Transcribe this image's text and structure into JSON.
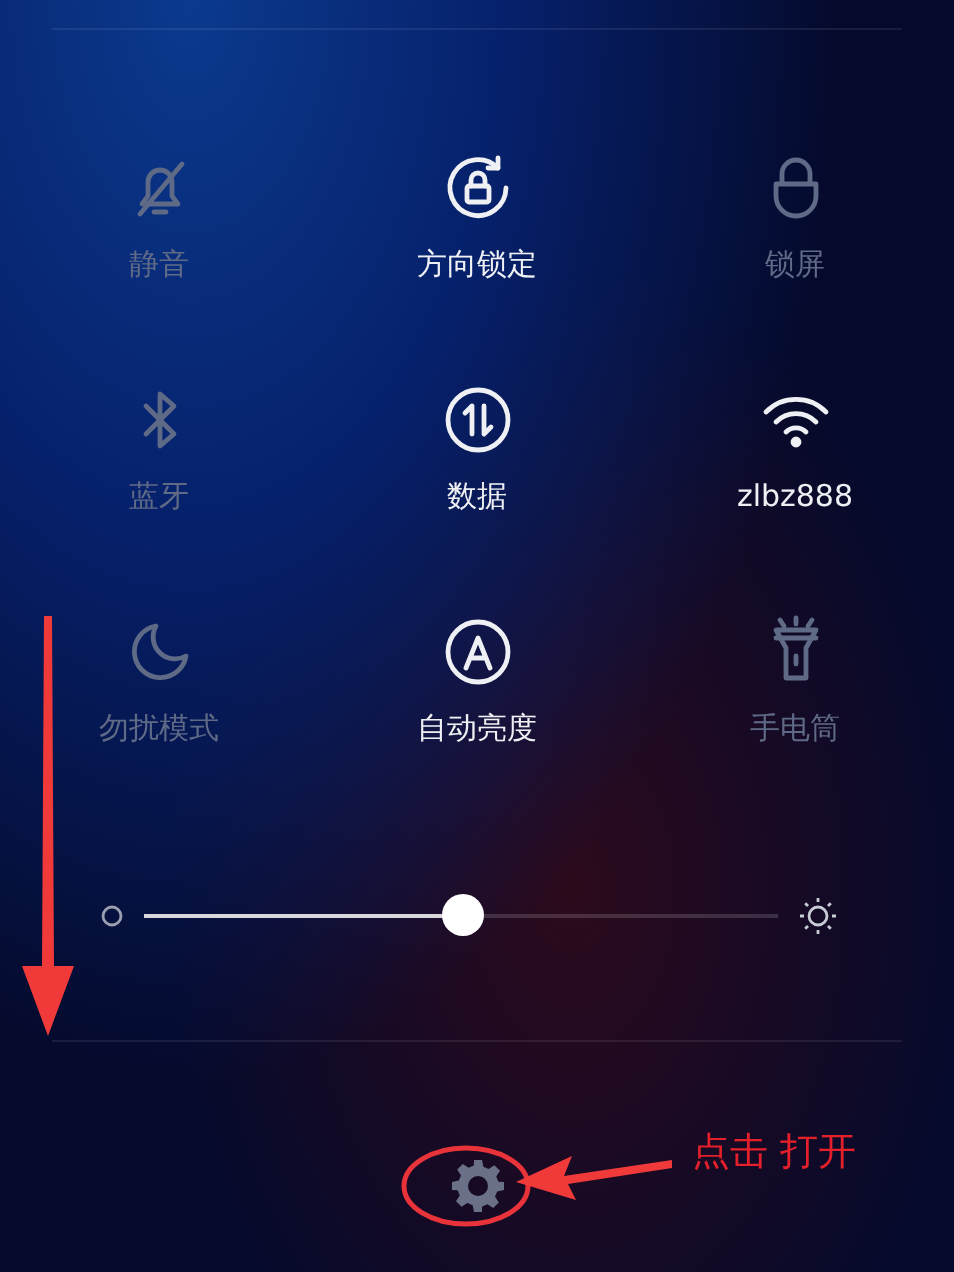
{
  "tiles": [
    {
      "kind": "mute",
      "label": "静音",
      "on": false
    },
    {
      "kind": "rotation-lock",
      "label": "方向锁定",
      "on": true
    },
    {
      "kind": "lock",
      "label": "锁屏",
      "on": false
    },
    {
      "kind": "bluetooth",
      "label": "蓝牙",
      "on": false
    },
    {
      "kind": "data",
      "label": "数据",
      "on": true
    },
    {
      "kind": "wifi",
      "label": "zlbz888",
      "on": true
    },
    {
      "kind": "moon",
      "label": "勿扰模式",
      "on": false
    },
    {
      "kind": "auto-brightness",
      "label": "自动亮度",
      "on": true
    },
    {
      "kind": "flashlight",
      "label": "手电筒",
      "on": false
    }
  ],
  "brightness": {
    "level": 0.5
  },
  "annotation": {
    "text": "点击 打开"
  }
}
